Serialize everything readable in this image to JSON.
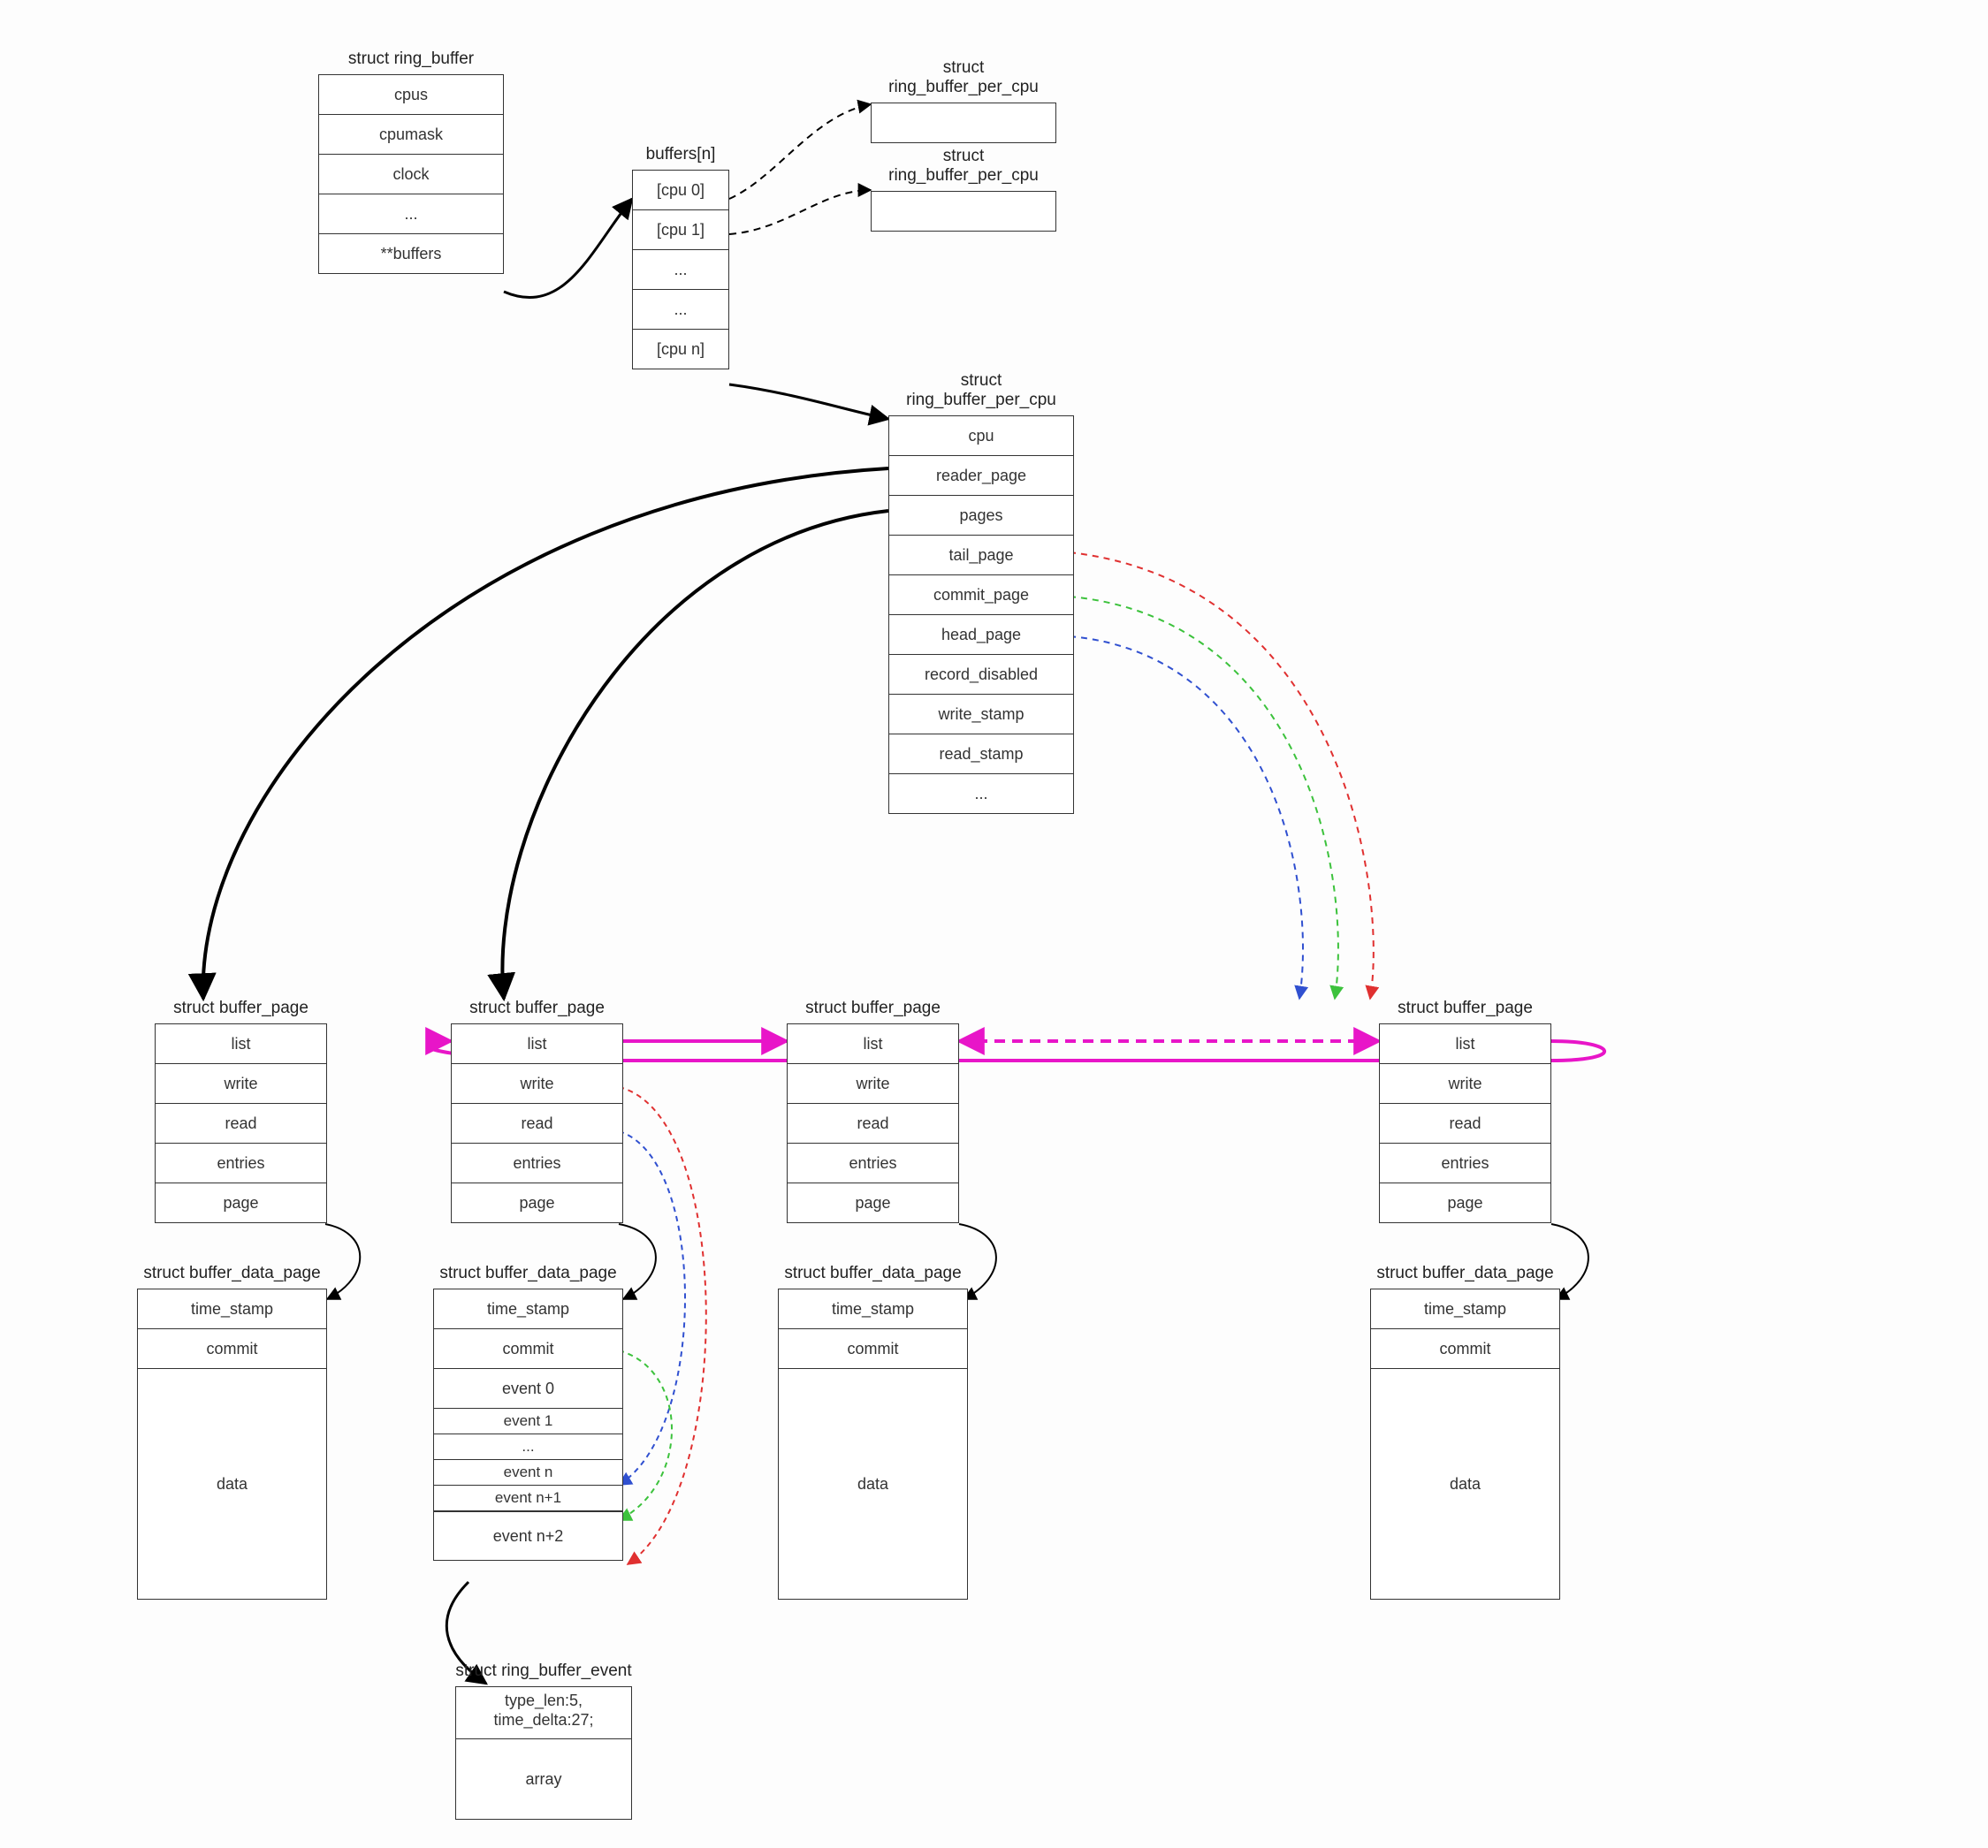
{
  "ring_buffer": {
    "title": "struct ring_buffer",
    "fields": [
      "cpus",
      "cpumask",
      "clock",
      "...",
      "**buffers"
    ]
  },
  "buffers_array": {
    "title": "buffers[n]",
    "items": [
      "[cpu 0]",
      "[cpu 1]",
      "...",
      "...",
      "[cpu n]"
    ]
  },
  "ring_buffer_per_cpu_empty": {
    "title": "struct ring_buffer_per_cpu"
  },
  "ring_buffer_per_cpu": {
    "title": "struct ring_buffer_per_cpu",
    "fields": [
      "cpu",
      "reader_page",
      "pages",
      "tail_page",
      "commit_page",
      "head_page",
      "record_disabled",
      "write_stamp",
      "read_stamp",
      "..."
    ]
  },
  "buffer_page": {
    "title": "struct buffer_page",
    "fields": [
      "list",
      "write",
      "read",
      "entries",
      "page"
    ]
  },
  "buffer_data_page": {
    "title": "struct buffer_data_page",
    "fields": [
      "time_stamp",
      "commit"
    ],
    "data": "data"
  },
  "buffer_data_page_events": {
    "title": "struct buffer_data_page",
    "fields": [
      "time_stamp",
      "commit",
      "event 0",
      "event 1",
      "...",
      "event n",
      "event n+1",
      "event n+2"
    ]
  },
  "ring_buffer_event": {
    "title": "struct ring_buffer_event",
    "line1": "type_len:5,",
    "line2": "time_delta:27;",
    "array": "array"
  }
}
